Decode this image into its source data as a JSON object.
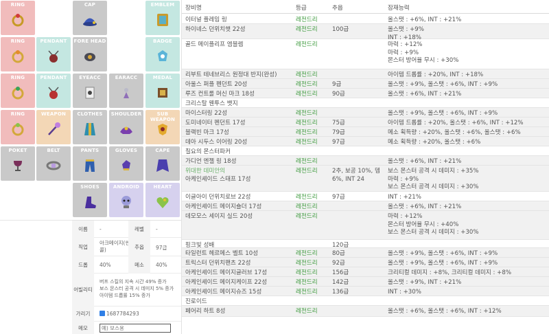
{
  "slots": [
    {
      "label": "RING"
    },
    {
      "label": "CAP"
    },
    {
      "label": "EMBLEM"
    },
    {
      "label": "RING"
    },
    {
      "label": "PENDANT"
    },
    {
      "label": "FORE HEAD"
    },
    {
      "label": "BADGE"
    },
    {
      "label": "RING"
    },
    {
      "label": "PENDANT"
    },
    {
      "label": "EYEACC"
    },
    {
      "label": "EARACC"
    },
    {
      "label": "MEDAL"
    },
    {
      "label": "RING"
    },
    {
      "label": "WEAPON"
    },
    {
      "label": "CLOTHES"
    },
    {
      "label": "SHOULDER"
    },
    {
      "label": "SUB WEAPON"
    },
    {
      "label": "POKET"
    },
    {
      "label": "BELT"
    },
    {
      "label": "PANTS"
    },
    {
      "label": "GLOVES"
    },
    {
      "label": "CAPE"
    },
    {
      "label": "SHOES"
    },
    {
      "label": "ANDROID"
    },
    {
      "label": "HEART"
    }
  ],
  "info": {
    "name_label": "이름",
    "name_value": "-",
    "level_label": "레벨",
    "level_value": "-",
    "job_label": "직업",
    "job_value": "아크메이지(썬,\n콜)",
    "force_label": "추옵",
    "force_value": "97급",
    "drop_label": "드롭",
    "drop_value": "40%",
    "meso_label": "메소",
    "meso_value": "40%",
    "ability_label": "어빌리티",
    "ability_value": "버프 스킬의 지속 시간 49% 증가\n보스 몬스터 공격 시 데미지 5% 증가\n아이템 드롭률 15% 증가",
    "hide_label": "가리기",
    "hide_value": "1687784293",
    "memo_label": "메모",
    "memo_placeholder": "예) 보스용"
  },
  "table": {
    "headers": {
      "name": "장비명",
      "grade": "등급",
      "force": "추옵",
      "potential": "잠재능력"
    },
    "rows": [
      {
        "name": "이터널 플레임 링",
        "grade": "레전드리",
        "force": "",
        "pot": "올스탯 : +6%, INT : +21%"
      },
      {
        "name": "하이네스 던위치햇 22성",
        "grade": "레전드리",
        "force": "100급",
        "pot": "올스탯 : +9%\nINT : +18%"
      },
      {
        "name": "골드 메이플리프 엠블렘",
        "grade": "레전드리",
        "force": "",
        "pot": "마력 : +12%\n마력 : +9%\n몬스터 방어율 무시 : +30%"
      },
      {
        "name": "리부트 테네브리스 원정대 반지(완성)",
        "grade": "레전드리",
        "force": "",
        "pot": "아이템 드롭률 : +20%, INT : +18%"
      },
      {
        "name": "아울스 퍼플 펜던트 20성",
        "grade": "레전드리",
        "force": "9급",
        "pot": "올스탯 : +9%, 올스탯 : +6%, INT : +9%"
      },
      {
        "name": "루즈 컨트롤 머신 마크 18성",
        "grade": "레전드리",
        "force": "90급",
        "pot": "올스탯 : +6%, INT : +21%"
      },
      {
        "name": "크리스탈 웬투스 뱃지",
        "grade": "",
        "force": "",
        "pot": ""
      },
      {
        "name": "마이스터링 22성",
        "grade": "레전드리",
        "force": "",
        "pot": "올스탯 : +9%, 올스탯 : +6%, INT : +9%"
      },
      {
        "name": "도미네이터 펜던트 17성",
        "grade": "레전드리",
        "force": "75급",
        "pot": "아이템 드롭률 : +20%, 올스탯 : +6%, INT : +12%"
      },
      {
        "name": "블랙빈 마크 17성",
        "grade": "레전드리",
        "force": "79급",
        "pot": "메소 획득량 : +20%, 올스탯 : +6%, 올스탯 : +6%"
      },
      {
        "name": "데아 시두스 이어링 20성",
        "grade": "레전드리",
        "force": "97급",
        "pot": "메소 획득량 : +20%, 올스탯 : +6%"
      },
      {
        "name": "칠요의 몬스터파커",
        "grade": "",
        "force": "",
        "pot": ""
      },
      {
        "name": "가디언 엔젤 링 18성",
        "grade": "레전드리",
        "force": "",
        "pot": "올스탯 : +6%, INT : +21%"
      },
      {
        "name": "위대한 데미안의\n아케인셰이드 스태프 17성",
        "grade": "레전드리",
        "force": "2추, 보공 10%, 뎀\n6%, INT 24",
        "pot": "보스 몬스터 공격 시 데미지 : +35%\n마력 : +9%\n보스 몬스터 공격 시 데미지 : +30%"
      },
      {
        "name": "이글아이 던위치로브 22성",
        "grade": "레전드리",
        "force": "97급",
        "pot": "INT : +21%"
      },
      {
        "name": "아케인셰이드 메이지숄더 17성",
        "grade": "레전드리",
        "force": "",
        "pot": "올스탯 : +6%, INT : +21%"
      },
      {
        "name": "데모모스 세이지 실드 20성",
        "grade": "레전드리",
        "force": "",
        "pot": "마력 : +12%\n몬스터 방어율 무시 : +40%\n보스 몬스터 공격 시 데미지 : +30%"
      },
      {
        "name": "핑크빛 성배",
        "grade": "",
        "force": "120급",
        "pot": ""
      },
      {
        "name": "타일런트 헤르메스 벨트 10성",
        "grade": "레전드리",
        "force": "80급",
        "pot": "올스탯 : +9%, 올스탯 : +6%, INT : +9%"
      },
      {
        "name": "트릭스터 던위치팬츠 22성",
        "grade": "레전드리",
        "force": "92급",
        "pot": "올스탯 : +9%, 올스탯 : +6%, INT : +9%"
      },
      {
        "name": "아케인셰이드 메이지글러브 17성",
        "grade": "레전드리",
        "force": "156급",
        "pot": "크리티컬 데미지 : +8%, 크리티컬 데미지 : +8%"
      },
      {
        "name": "아케인셰이드 메이지케이프 22성",
        "grade": "레전드리",
        "force": "142급",
        "pot": "올스탯 : +9%, INT : +21%"
      },
      {
        "name": "아케인셰이드 메이지슈즈 15성",
        "grade": "레전드리",
        "force": "136급",
        "pot": "INT : +30%"
      },
      {
        "name": "진로이드",
        "grade": "",
        "force": "",
        "pot": ""
      },
      {
        "name": "페어리 하트 8성",
        "grade": "레전드리",
        "force": "",
        "pot": "올스탯 : +6%, 올스탯 : +6%, INT : +12%"
      }
    ]
  },
  "colors": {
    "legendary": "#3d9a3d",
    "ring_bg": "#f1bcbc",
    "teal_bg": "#c4e7e1",
    "orange_bg": "#f3d7b6",
    "gray_bg": "#c9c9c9",
    "purple_bg": "#d6d1ee"
  }
}
